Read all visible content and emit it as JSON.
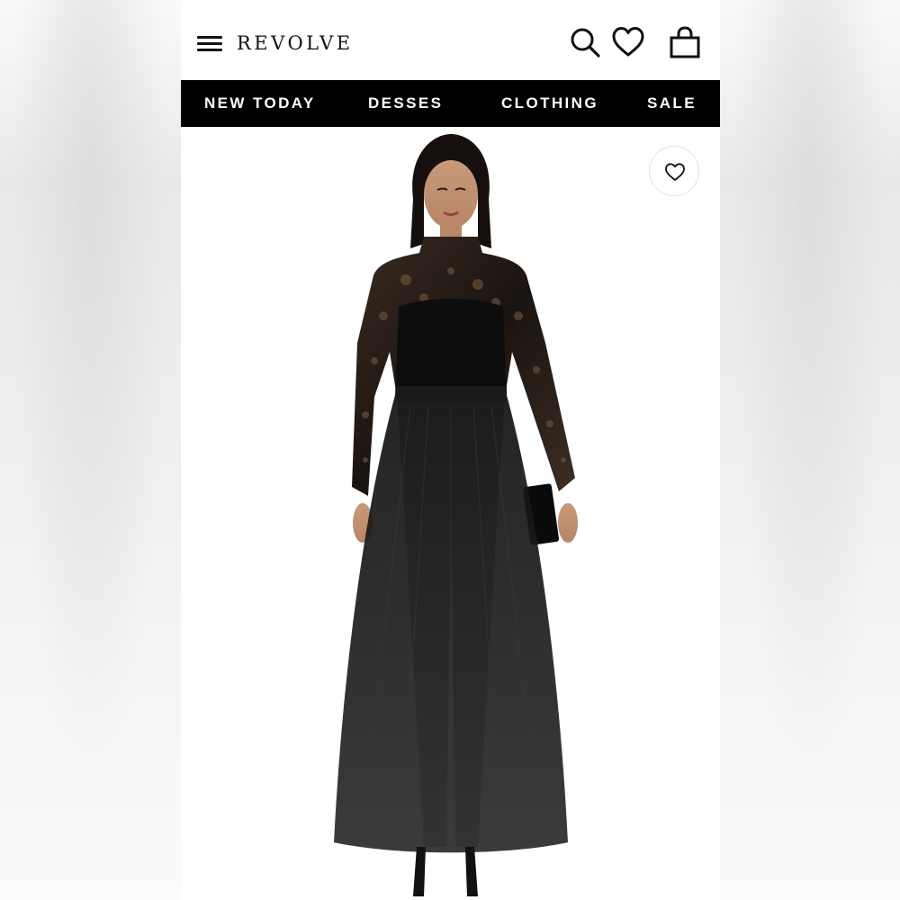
{
  "brand": {
    "logo_text": "REVOLVE"
  },
  "header": {
    "icons": [
      "menu-icon",
      "search-icon",
      "heart-icon",
      "shopping-bag-icon"
    ]
  },
  "nav": {
    "items": [
      {
        "label": "NEW TODAY"
      },
      {
        "label": "DESSES"
      },
      {
        "label": "CLOTHING"
      },
      {
        "label": "SALE"
      }
    ]
  },
  "product": {
    "image_alt_icon": "product-photo",
    "wishlist_icon": "heart-outline-icon"
  },
  "colors": {
    "nav_background": "#000000",
    "nav_text": "#ffffff",
    "header_background": "#ffffff",
    "icon_color": "#111111"
  }
}
